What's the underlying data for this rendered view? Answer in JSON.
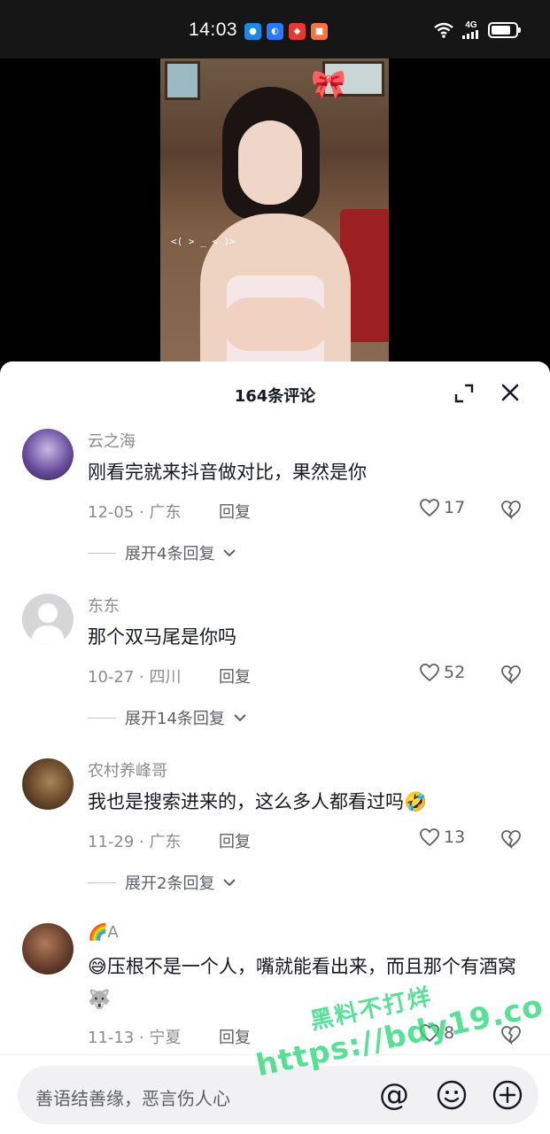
{
  "status_bar": {
    "time": "14:03",
    "network": "4G",
    "app_icons": [
      "chat-app-icon",
      "browser-app-icon",
      "shopping-app-icon",
      "message-app-icon"
    ],
    "battery_level": 0.8
  },
  "video": {
    "overlay_mark": "<( > _ < )>"
  },
  "sheet": {
    "title": "164条评论"
  },
  "comments": [
    {
      "user": "云之海",
      "text": "刚看完就来抖音做对比，果然是你",
      "meta": "12-05 · 广东",
      "reply_label": "回复",
      "likes": "17",
      "expand_label": "展开4条回复"
    },
    {
      "user": "东东",
      "text": "那个双马尾是你吗",
      "meta": "10-27 · 四川",
      "reply_label": "回复",
      "likes": "52",
      "expand_label": "展开14条回复"
    },
    {
      "user": "农村养峰哥",
      "text": "我也是搜索进来的，这么多人都看过吗🤣",
      "meta": "11-29 · 广东",
      "reply_label": "回复",
      "likes": "13",
      "expand_label": "展开2条回复"
    },
    {
      "user": "🌈A",
      "text": "😅压根不是一个人，嘴就能看出来，而且那个有酒窝🐺",
      "meta": "11-13 · 宁夏",
      "reply_label": "回复",
      "likes": "8"
    }
  ],
  "input": {
    "placeholder": "善语结善缘，恶言伤人心",
    "at_label": "@"
  },
  "watermark": {
    "line1": "黑料不打烊",
    "line2": "https://bdy19.co"
  },
  "colors": {
    "accent_green": "#28d778",
    "text_primary": "#161823",
    "text_secondary": "#8a8b91"
  }
}
